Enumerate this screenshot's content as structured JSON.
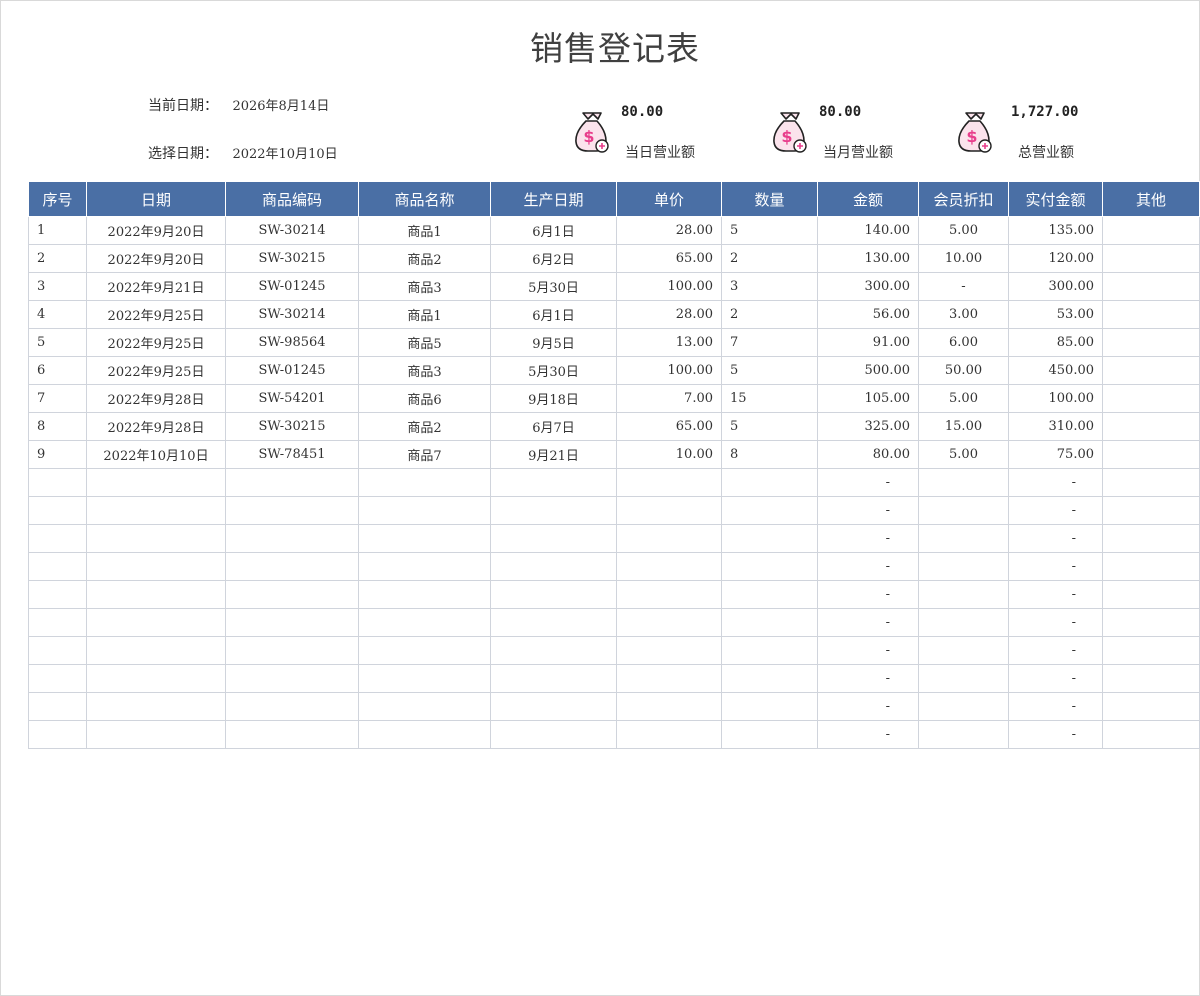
{
  "title": "销售登记表",
  "current_date": {
    "label": "当前日期：",
    "value": "2026年8月14日"
  },
  "select_date": {
    "label": "选择日期：",
    "value": "2022年10月10日"
  },
  "kpis": [
    {
      "amount": "80.00",
      "label": "当日营业额",
      "icon": "money-bag-icon"
    },
    {
      "amount": "80.00",
      "label": "当月营业额",
      "icon": "money-bag-icon"
    },
    {
      "amount": "1,727.00",
      "label": "总营业额",
      "icon": "money-bag-icon"
    }
  ],
  "colors": {
    "header_bg": "#4a6fa5",
    "icon_pink": "#e83e8c",
    "icon_fill": "#fbe3ec"
  },
  "table": {
    "columns": [
      "序号",
      "日期",
      "商品编码",
      "商品名称",
      "生产日期",
      "单价",
      "数量",
      "金额",
      "会员折扣",
      "实付金额",
      "其他"
    ],
    "rows": [
      [
        "1",
        "2022年9月20日",
        "SW-30214",
        "商品1",
        "6月1日",
        "28.00",
        "5",
        "140.00",
        "5.00",
        "135.00",
        ""
      ],
      [
        "2",
        "2022年9月20日",
        "SW-30215",
        "商品2",
        "6月2日",
        "65.00",
        "2",
        "130.00",
        "10.00",
        "120.00",
        ""
      ],
      [
        "3",
        "2022年9月21日",
        "SW-01245",
        "商品3",
        "5月30日",
        "100.00",
        "3",
        "300.00",
        "-",
        "300.00",
        ""
      ],
      [
        "4",
        "2022年9月25日",
        "SW-30214",
        "商品1",
        "6月1日",
        "28.00",
        "2",
        "56.00",
        "3.00",
        "53.00",
        ""
      ],
      [
        "5",
        "2022年9月25日",
        "SW-98564",
        "商品5",
        "9月5日",
        "13.00",
        "7",
        "91.00",
        "6.00",
        "85.00",
        ""
      ],
      [
        "6",
        "2022年9月25日",
        "SW-01245",
        "商品3",
        "5月30日",
        "100.00",
        "5",
        "500.00",
        "50.00",
        "450.00",
        ""
      ],
      [
        "7",
        "2022年9月28日",
        "SW-54201",
        "商品6",
        "9月18日",
        "7.00",
        "15",
        "105.00",
        "5.00",
        "100.00",
        ""
      ],
      [
        "8",
        "2022年9月28日",
        "SW-30215",
        "商品2",
        "6月7日",
        "65.00",
        "5",
        "325.00",
        "15.00",
        "310.00",
        ""
      ],
      [
        "9",
        "2022年10月10日",
        "SW-78451",
        "商品7",
        "9月21日",
        "10.00",
        "8",
        "80.00",
        "5.00",
        "75.00",
        ""
      ],
      [
        "",
        "",
        "",
        "",
        "",
        "",
        "",
        "-",
        "",
        "-",
        ""
      ],
      [
        "",
        "",
        "",
        "",
        "",
        "",
        "",
        "-",
        "",
        "-",
        ""
      ],
      [
        "",
        "",
        "",
        "",
        "",
        "",
        "",
        "-",
        "",
        "-",
        ""
      ],
      [
        "",
        "",
        "",
        "",
        "",
        "",
        "",
        "-",
        "",
        "-",
        ""
      ],
      [
        "",
        "",
        "",
        "",
        "",
        "",
        "",
        "-",
        "",
        "-",
        ""
      ],
      [
        "",
        "",
        "",
        "",
        "",
        "",
        "",
        "-",
        "",
        "-",
        ""
      ],
      [
        "",
        "",
        "",
        "",
        "",
        "",
        "",
        "-",
        "",
        "-",
        ""
      ],
      [
        "",
        "",
        "",
        "",
        "",
        "",
        "",
        "-",
        "",
        "-",
        ""
      ],
      [
        "",
        "",
        "",
        "",
        "",
        "",
        "",
        "-",
        "",
        "-",
        ""
      ],
      [
        "",
        "",
        "",
        "",
        "",
        "",
        "",
        "-",
        "",
        "-",
        ""
      ]
    ]
  }
}
